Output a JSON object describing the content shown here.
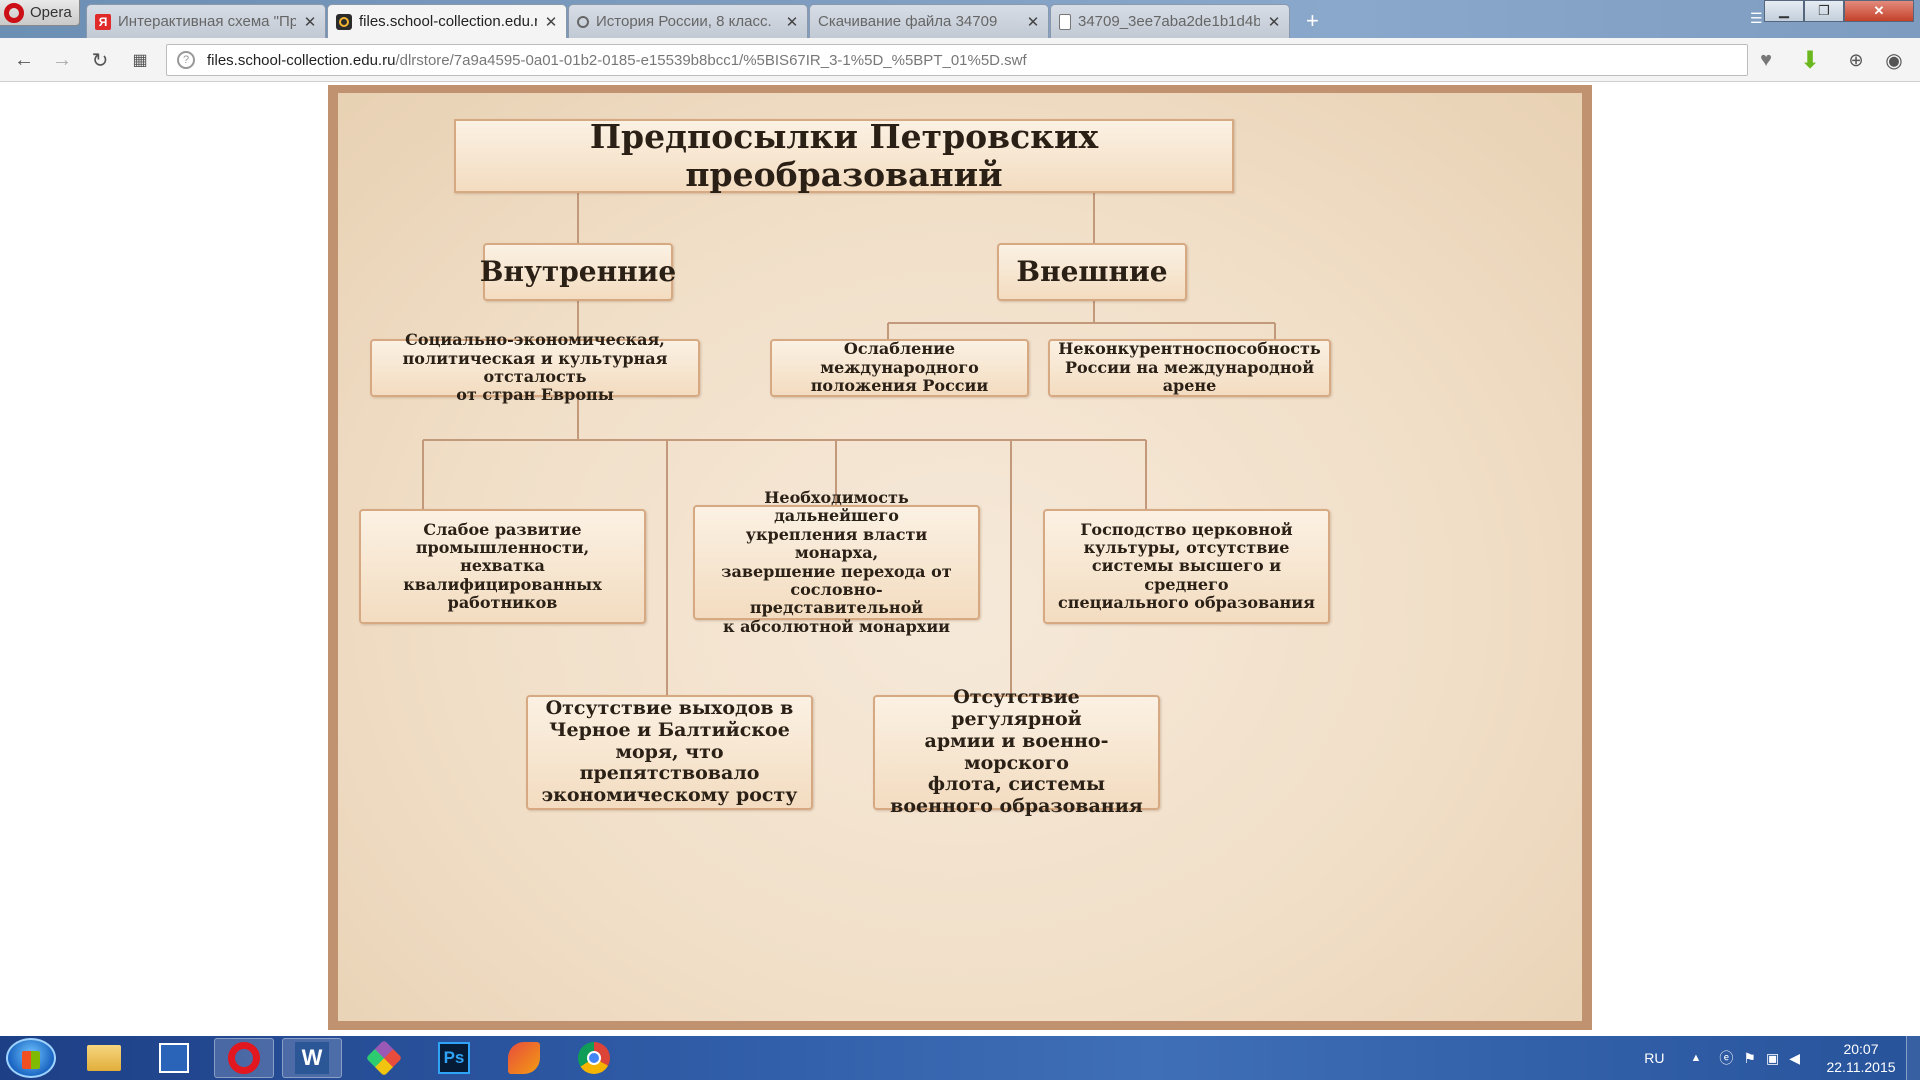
{
  "browser": {
    "menu_label": "Opera",
    "tabs": [
      {
        "label": "Интерактивная схема \"Пр",
        "icon": "yandex-icon"
      },
      {
        "label": "files.school-collection.edu.r",
        "icon": "school-collection-icon"
      },
      {
        "label": "История России, 8 класс.",
        "icon": "search-icon"
      },
      {
        "label": "Скачивание файла 34709",
        "icon": "none"
      },
      {
        "label": "34709_3ee7aba2de1b1d4b",
        "icon": "document-icon"
      }
    ],
    "new_tab": "+",
    "url_host": "files.school-collection.edu.ru",
    "url_path": "/dlrstore/7a9a4595-0a01-01b2-0185-e15539b8bcc1/%5BIS67IR_3-1%5D_%5BPT_01%5D.swf"
  },
  "diagram": {
    "title": "Предпосылки Петровских преобразований",
    "internal": {
      "heading": "Внутренние",
      "backwardness": "Социально-экономическая,\nполитическая и культурная отсталость\nот стран Европы",
      "industry": "Слабое развитие\nпромышленности,\nнехватка\nквалифицированных\nработников",
      "monarchy": "Необходимость дальнейшего\nукрепления власти монарха,\nзавершение перехода от\nсословно-представительной\nк абсолютной монархии",
      "church": "Господство церковной\nкультуры, отсутствие\nсистемы высшего и среднего\nспециального образования",
      "sea": "Отсутствие выходов в\nЧерное и Балтийское\nморя, что препятствовало\nэкономическому росту",
      "army": "Отсутствие регулярной\nармии  и военно-морского\nфлота, системы\nвоенного образования"
    },
    "external": {
      "heading": "Внешние",
      "weakening": "Ослабление международного\nположения России",
      "uncompetitive": "Неконкурентноспособность\nРоссии на международной арене"
    }
  },
  "taskbar": {
    "language": "RU",
    "time": "20:07",
    "date": "22.11.2015"
  },
  "colors": {
    "frame": "#c09270",
    "box_border": "#d6a983",
    "connector": "#c2997a",
    "text": "#2a2016"
  }
}
